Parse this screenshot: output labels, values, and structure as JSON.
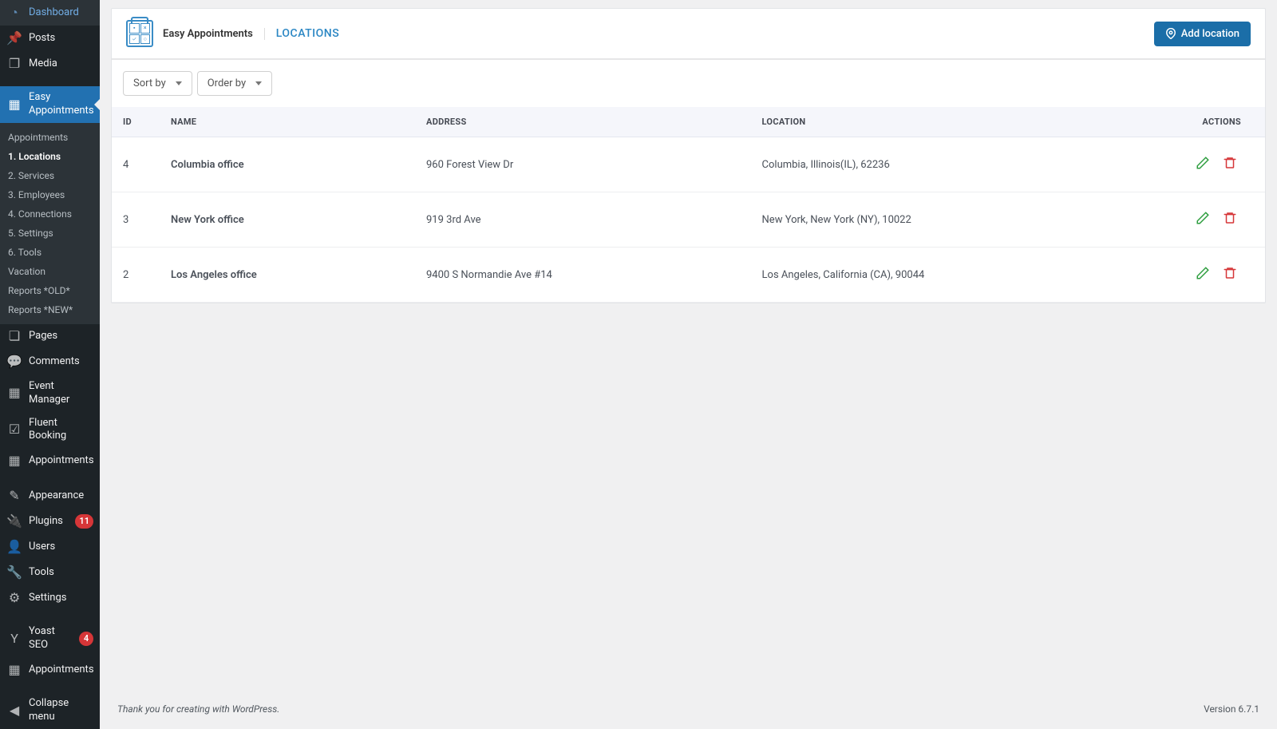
{
  "sidebar": {
    "items": [
      {
        "label": "Dashboard",
        "icon": "dashboard-icon",
        "glyph": "◔"
      },
      {
        "label": "Posts",
        "icon": "pin-icon",
        "glyph": "📌"
      },
      {
        "label": "Media",
        "icon": "media-icon",
        "glyph": "❐"
      },
      {
        "label": "Easy Appointments",
        "icon": "calendar-icon",
        "glyph": "▦",
        "current": true
      },
      {
        "label": "Pages",
        "icon": "pages-icon",
        "glyph": "❏"
      },
      {
        "label": "Comments",
        "icon": "comments-icon",
        "glyph": "💬"
      },
      {
        "label": "Event Manager",
        "icon": "calendar-icon",
        "glyph": "▦"
      },
      {
        "label": "Fluent Booking",
        "icon": "booking-icon",
        "glyph": "☑"
      },
      {
        "label": "Appointments",
        "icon": "calendar-icon",
        "glyph": "▦"
      },
      {
        "label": "Appearance",
        "icon": "brush-icon",
        "glyph": "✎"
      },
      {
        "label": "Plugins",
        "icon": "plug-icon",
        "glyph": "🔌",
        "badge": "11"
      },
      {
        "label": "Users",
        "icon": "user-icon",
        "glyph": "👤"
      },
      {
        "label": "Tools",
        "icon": "wrench-icon",
        "glyph": "🔧"
      },
      {
        "label": "Settings",
        "icon": "sliders-icon",
        "glyph": "⚙"
      },
      {
        "label": "Yoast SEO",
        "icon": "yoast-icon",
        "glyph": "Y",
        "badge": "4"
      },
      {
        "label": "Appointments",
        "icon": "calendar-icon",
        "glyph": "▦"
      },
      {
        "label": "Collapse menu",
        "icon": "collapse-icon",
        "glyph": "◀"
      }
    ],
    "submenu": [
      {
        "label": "Appointments"
      },
      {
        "label": "1. Locations",
        "current": true
      },
      {
        "label": "2. Services"
      },
      {
        "label": "3. Employees"
      },
      {
        "label": "4. Connections"
      },
      {
        "label": "5. Settings"
      },
      {
        "label": "6. Tools"
      },
      {
        "label": "Vacation"
      },
      {
        "label": "Reports *OLD*"
      },
      {
        "label": "Reports *NEW*"
      }
    ]
  },
  "header": {
    "app_title": "Easy Appointments",
    "page_title": "LOCATIONS",
    "add_button": "Add location"
  },
  "toolbar": {
    "sort_by": "Sort by",
    "order_by": "Order by"
  },
  "table": {
    "columns": {
      "id": "ID",
      "name": "NAME",
      "address": "ADDRESS",
      "location": "LOCATION",
      "actions": "ACTIONS"
    },
    "rows": [
      {
        "id": "4",
        "name": "Columbia office",
        "address": "960 Forest View Dr",
        "location": "Columbia, Illinois(IL), 62236"
      },
      {
        "id": "3",
        "name": "New York office",
        "address": "919 3rd Ave",
        "location": "New York, New York (NY), 10022"
      },
      {
        "id": "2",
        "name": "Los Angeles office",
        "address": "9400 S Normandie Ave #14",
        "location": "Los Angeles, California (CA), 90044"
      }
    ]
  },
  "footer": {
    "credit": "Thank you for creating with WordPress.",
    "version": "Version 6.7.1"
  }
}
